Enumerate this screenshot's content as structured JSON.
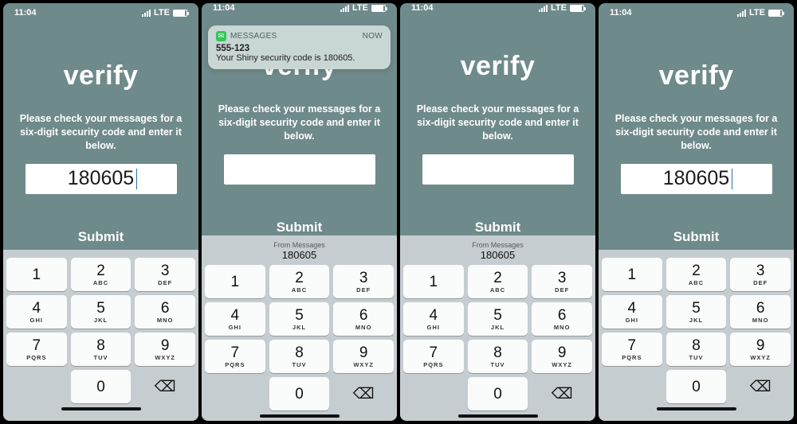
{
  "status": {
    "time": "11:04",
    "carrier": "LTE"
  },
  "page": {
    "title": "verify",
    "instruction": "Please check your messages for a six-digit security code and enter it below.",
    "submit_label": "Submit"
  },
  "notification": {
    "app_name": "MESSAGES",
    "timestamp": "now",
    "sender": "555-123",
    "body": "Your Shiny security code is 180605."
  },
  "suggestion": {
    "label": "From Messages",
    "code": "180605"
  },
  "screens": [
    {
      "code_value": "180605",
      "cursor": "after",
      "show_notif": false,
      "show_suggestion": false
    },
    {
      "code_value": "",
      "cursor": "none",
      "show_notif": true,
      "show_suggestion": true
    },
    {
      "code_value": "",
      "cursor": "center",
      "show_notif": false,
      "show_suggestion": true
    },
    {
      "code_value": "180605",
      "cursor": "after",
      "show_notif": false,
      "show_suggestion": false
    }
  ],
  "keypad": [
    [
      {
        "n": "1",
        "l": ""
      },
      {
        "n": "2",
        "l": "ABC"
      },
      {
        "n": "3",
        "l": "DEF"
      }
    ],
    [
      {
        "n": "4",
        "l": "GHI"
      },
      {
        "n": "5",
        "l": "JKL"
      },
      {
        "n": "6",
        "l": "MNO"
      }
    ],
    [
      {
        "n": "7",
        "l": "PQRS"
      },
      {
        "n": "8",
        "l": "TUV"
      },
      {
        "n": "9",
        "l": "WXYZ"
      }
    ],
    [
      {
        "n": "",
        "l": "",
        "blank": true
      },
      {
        "n": "0",
        "l": ""
      },
      {
        "n": "⌫",
        "l": "",
        "del": true
      }
    ]
  ]
}
